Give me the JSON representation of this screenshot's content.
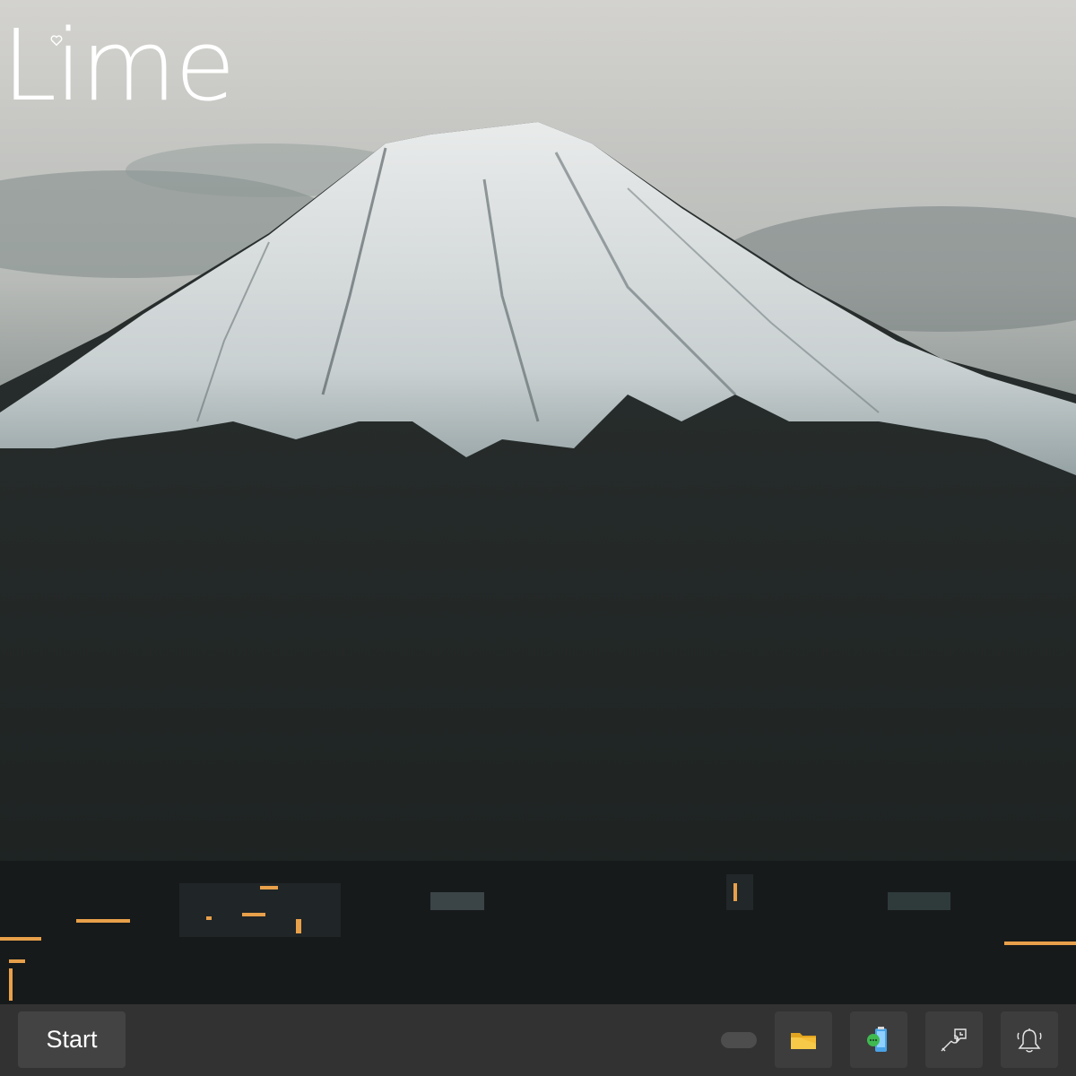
{
  "desktop": {
    "logo_text": "Lime",
    "wallpaper": "mount-fuji-photo"
  },
  "taskbar": {
    "start_label": "Start",
    "tray": [
      {
        "name": "file-explorer-icon"
      },
      {
        "name": "messages-icon"
      },
      {
        "name": "tools-icon"
      },
      {
        "name": "bell-icon"
      }
    ]
  },
  "colors": {
    "taskbar": "#323232",
    "start_button": "#434343",
    "tray_button": "#3d3d3d",
    "folder_yellow": "#f2c33b",
    "message_green": "#3fb950",
    "phone_blue": "#4aa3e6"
  }
}
